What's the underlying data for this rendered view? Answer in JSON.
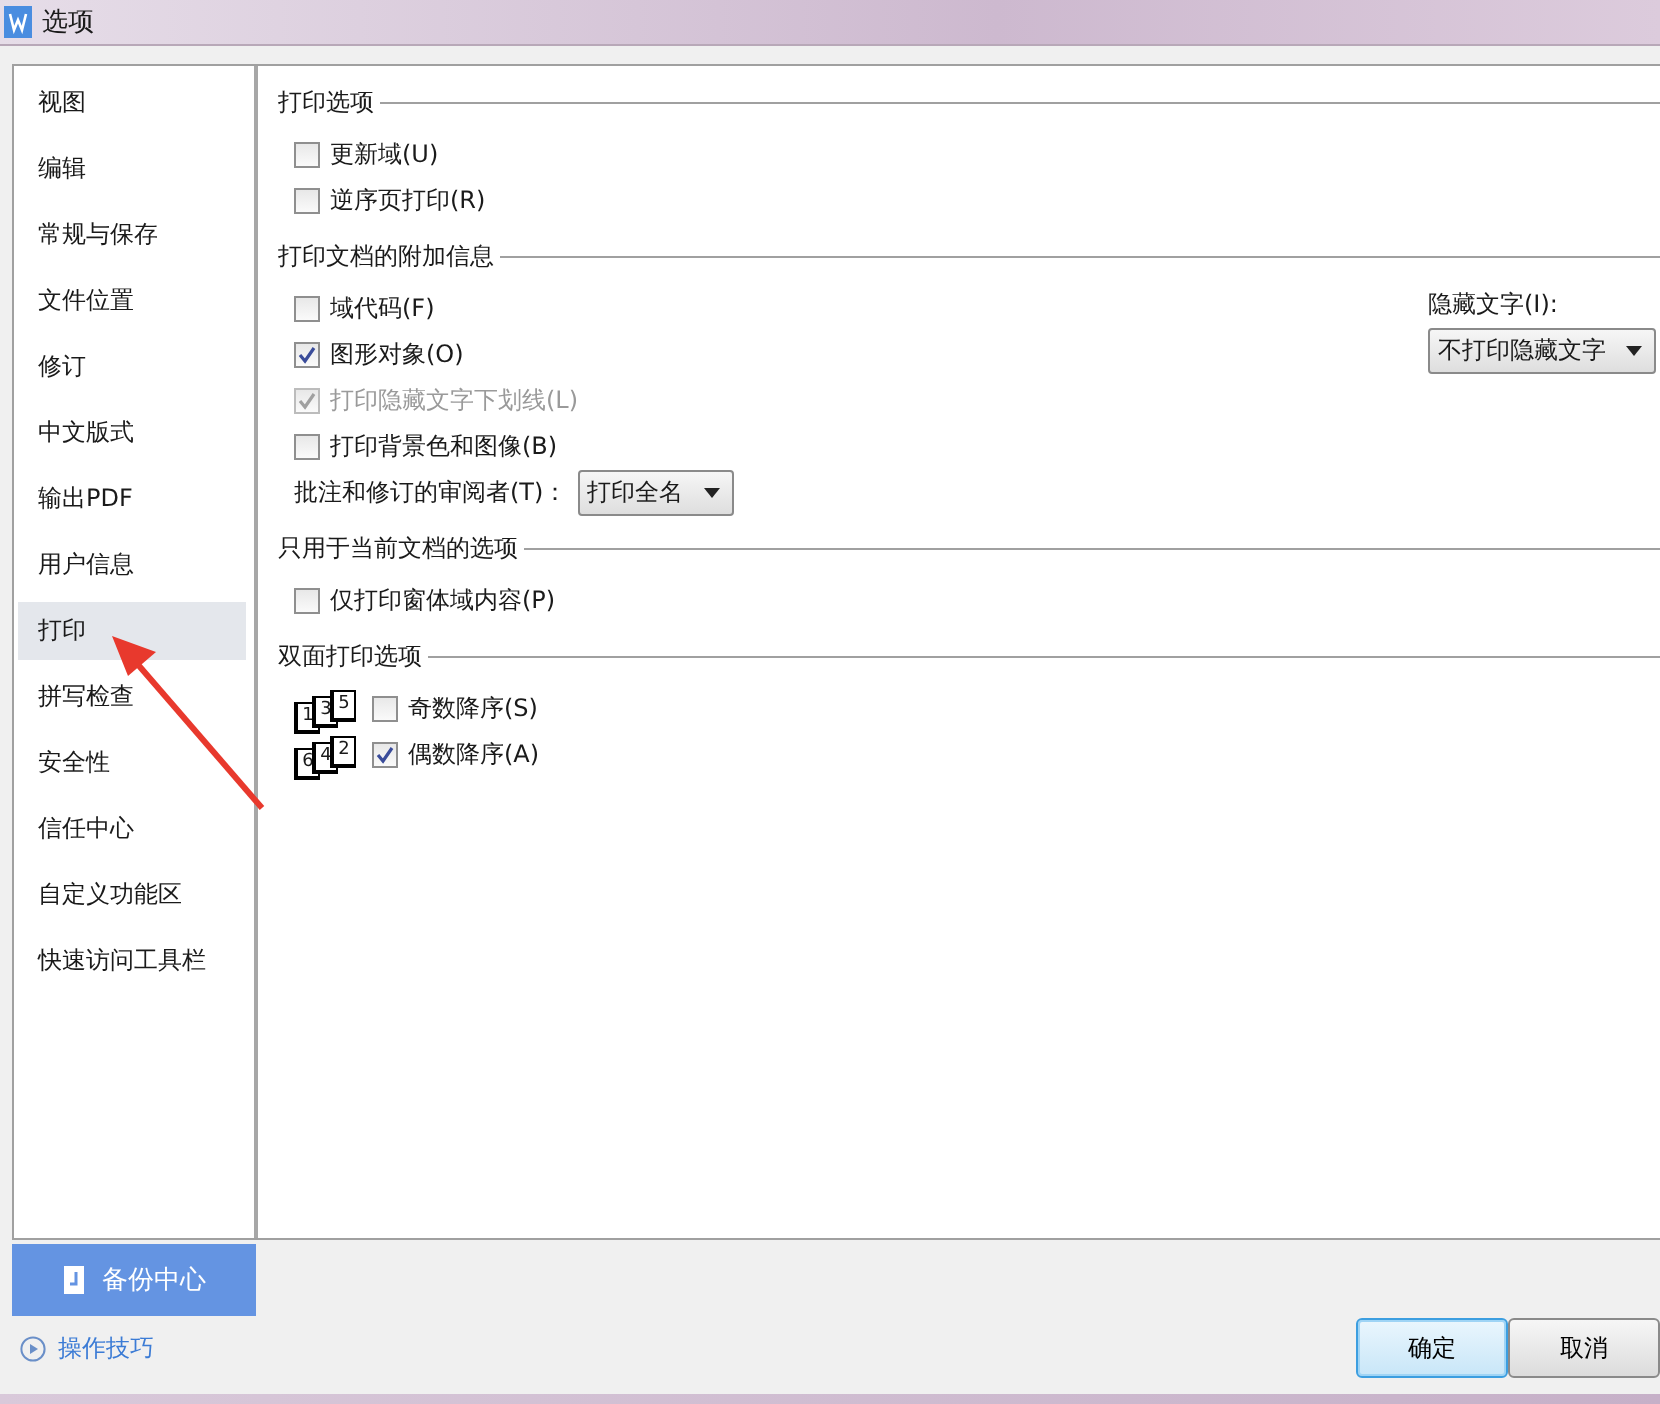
{
  "window": {
    "title": "选项"
  },
  "sidebar": {
    "items": [
      {
        "label": "视图",
        "selected": false
      },
      {
        "label": "编辑",
        "selected": false
      },
      {
        "label": "常规与保存",
        "selected": false
      },
      {
        "label": "文件位置",
        "selected": false
      },
      {
        "label": "修订",
        "selected": false
      },
      {
        "label": "中文版式",
        "selected": false
      },
      {
        "label": "输出PDF",
        "selected": false
      },
      {
        "label": "用户信息",
        "selected": false
      },
      {
        "label": "打印",
        "selected": true
      },
      {
        "label": "拼写检查",
        "selected": false
      },
      {
        "label": "安全性",
        "selected": false
      },
      {
        "label": "信任中心",
        "selected": false
      },
      {
        "label": "自定义功能区",
        "selected": false
      },
      {
        "label": "快速访问工具栏",
        "selected": false
      }
    ],
    "backup_button": "备份中心",
    "tips_link": "操作技巧"
  },
  "sections": [
    {
      "title": "打印选项",
      "items": [
        {
          "kind": "checkbox",
          "label": "更新域(U)",
          "checked": false,
          "disabled": false
        },
        {
          "kind": "checkbox",
          "label": "逆序页打印(R)",
          "checked": false,
          "disabled": false
        }
      ]
    },
    {
      "title": "打印文档的附加信息",
      "side_field": {
        "label": "隐藏文字(I):",
        "value": "不打印隐藏文字"
      },
      "items": [
        {
          "kind": "checkbox",
          "label": "域代码(F)",
          "checked": false,
          "disabled": false
        },
        {
          "kind": "checkbox",
          "label": "图形对象(O)",
          "checked": true,
          "disabled": false
        },
        {
          "kind": "checkbox",
          "label": "打印隐藏文字下划线(L)",
          "checked": true,
          "disabled": true
        },
        {
          "kind": "checkbox",
          "label": "打印背景色和图像(B)",
          "checked": false,
          "disabled": false
        },
        {
          "kind": "select",
          "label": "批注和修订的审阅者(T)：",
          "value": "打印全名"
        }
      ]
    },
    {
      "title": "只用于当前文档的选项",
      "items": [
        {
          "kind": "checkbox",
          "label": "仅打印窗体域内容(P)",
          "checked": false,
          "disabled": false
        }
      ]
    },
    {
      "title": "双面打印选项",
      "items": [
        {
          "kind": "duplex",
          "pages": [
            "1",
            "3",
            "5"
          ],
          "label": "奇数降序(S)",
          "checked": false
        },
        {
          "kind": "duplex",
          "pages": [
            "6",
            "4",
            "2"
          ],
          "label": "偶数降序(A)",
          "checked": true
        }
      ]
    }
  ],
  "buttons": [
    {
      "label": "确定",
      "selected": true
    },
    {
      "label": "取消",
      "selected": false
    }
  ]
}
